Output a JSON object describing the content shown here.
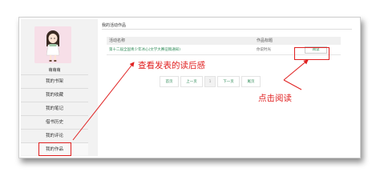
{
  "user": {
    "name": "萌萌萌"
  },
  "sidebar": {
    "items": [
      {
        "label": "我的书架"
      },
      {
        "label": "我的收藏"
      },
      {
        "label": "我的笔记"
      },
      {
        "label": "借书历史"
      },
      {
        "label": "我的评论"
      },
      {
        "label": "我的作品"
      }
    ],
    "active_index": 5
  },
  "main": {
    "panel_title": "我的活动作品",
    "table": {
      "columns": [
        "活动名称",
        "作品标题"
      ],
      "rows": [
        {
          "activity": "第十二届全国青少年冰心(文学大赛征稿通知)",
          "title": "你说时光",
          "action": "阅读"
        }
      ]
    },
    "pager": [
      "首页",
      "上一页",
      "1",
      "下一页",
      "尾页"
    ]
  },
  "annotations": {
    "view_review": "查看发表的读后感",
    "click_read": "点击阅读"
  },
  "colors": {
    "annotation": "#e02020",
    "link": "#2e8b57"
  }
}
